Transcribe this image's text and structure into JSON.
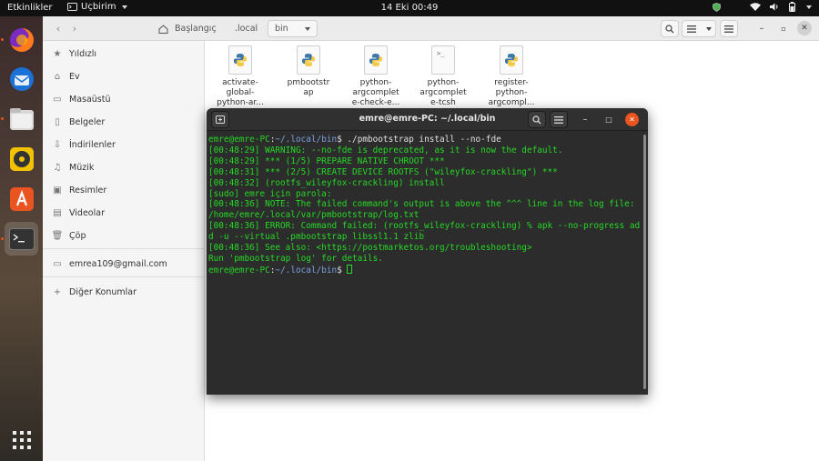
{
  "topbar": {
    "activities": "Etkinlikler",
    "app_menu": "Uçbirim",
    "clock": "14 Eki  00:49"
  },
  "dock": {
    "items": [
      {
        "name": "firefox-icon"
      },
      {
        "name": "thunderbird-icon"
      },
      {
        "name": "files-icon"
      },
      {
        "name": "rhythmbox-icon"
      },
      {
        "name": "software-icon"
      },
      {
        "name": "terminal-icon"
      },
      {
        "name": "show-apps-icon"
      }
    ]
  },
  "file_manager": {
    "breadcrumbs": [
      "Başlangıç",
      ".local",
      "bin"
    ],
    "sidebar": {
      "items": [
        {
          "icon": "star-icon",
          "label": "Yıldızlı"
        },
        {
          "icon": "home-icon",
          "label": "Ev"
        },
        {
          "icon": "desktop-icon",
          "label": "Masaüstü"
        },
        {
          "icon": "documents-icon",
          "label": "Belgeler"
        },
        {
          "icon": "downloads-icon",
          "label": "İndirilenler"
        },
        {
          "icon": "music-icon",
          "label": "Müzik"
        },
        {
          "icon": "pictures-icon",
          "label": "Resimler"
        },
        {
          "icon": "videos-icon",
          "label": "Videolar"
        },
        {
          "icon": "trash-icon",
          "label": "Çöp"
        }
      ],
      "account": "emrea109@gmail.com",
      "other": "Diğer Konumlar"
    },
    "files": [
      {
        "type": "python",
        "label": "activate-\nglobal-\npython-ar..."
      },
      {
        "type": "python",
        "label": "pmbootstr\nap"
      },
      {
        "type": "python",
        "label": "python-\nargcomplet\ne-check-e..."
      },
      {
        "type": "terminal",
        "label": "python-\nargcomplet\ne-tcsh"
      },
      {
        "type": "python",
        "label": "register-\npython-\nargcompl..."
      }
    ]
  },
  "terminal": {
    "title": "emre@emre-PC: ~/.local/bin",
    "prompt_user": "emre@emre-PC",
    "prompt_path": "~/.local/bin",
    "command": "$ ./pmbootstrap install --no-fde",
    "output": [
      "[00:48:29] WARNING: --no-fde is deprecated, as it is now the default.",
      "[00:48:29] *** (1/5) PREPARE NATIVE CHROOT ***",
      "[00:48:31] *** (2/5) CREATE DEVICE ROOTFS (\"wileyfox-crackling\") ***",
      "[00:48:32] (rootfs_wileyfox-crackling) install",
      "[sudo] emre için parola:",
      "[00:48:36] NOTE: The failed command's output is above the ^^^ line in the log file: /home/emre/.local/var/pmbootstrap/log.txt",
      "[00:48:36] ERROR: Command failed: (rootfs_wileyfox-crackling) % apk --no-progress add -u --virtual .pmbootstrap libssl1.1 zlib",
      "[00:48:36] See also: <https://postmarketos.org/troubleshooting>",
      "Run 'pmbootstrap log' for details."
    ],
    "final_prompt_suffix": "$ "
  }
}
